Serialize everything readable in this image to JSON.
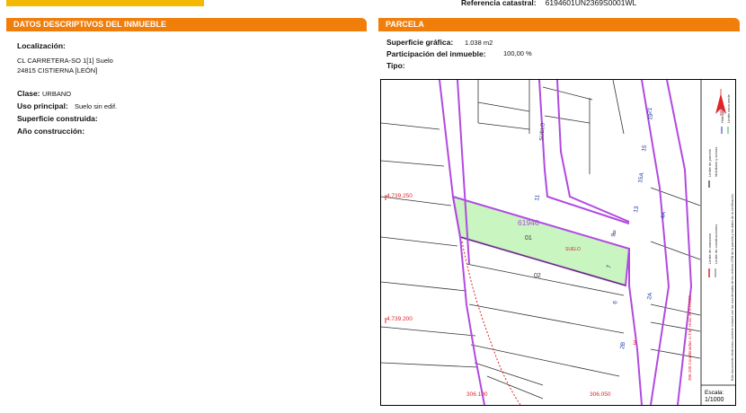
{
  "header": {
    "ref_label": "Referencia catastral:",
    "ref_value": "6194601UN2369S0001WL"
  },
  "left": {
    "title": "DATOS DESCRIPTIVOS DEL INMUEBLE",
    "localizacion_label": "Localización:",
    "address_line1": "CL CARRETERA-SO 1[1] Suelo",
    "address_line2": "24815 CISTIERNA [LEÓN]",
    "clase_label": "Clase:",
    "clase_value": "URBANO",
    "uso_label": "Uso principal:",
    "uso_value": "Suelo sin edif.",
    "superficie_construida_label": "Superficie construida:",
    "ano_label": "Año construcción:"
  },
  "right": {
    "title": "PARCELA",
    "superficie_label": "Superficie gráfica:",
    "superficie_value": "1.038 m2",
    "participacion_label": "Participación del inmueble:",
    "participacion_value": "100,00 %",
    "tipo_label": "Tipo:"
  },
  "map": {
    "parcel_number": "61946",
    "sub01": "01",
    "sub02": "02",
    "suelo": "SUELO",
    "coord_y1": "4.739.250",
    "coord_y2": "4.739.200",
    "coord_x1": "306.100",
    "coord_x2": "306.050",
    "street_numbers": [
      "21",
      "19",
      "15",
      "15A",
      "13",
      "11",
      "9",
      "7",
      "6",
      "4A",
      "2A",
      "2B"
    ],
    "other_labels": [
      "SUELO",
      "8",
      "3"
    ],
    "legend": [
      "Límite de manzana",
      "Límite de parcela",
      "Límite de construcciones",
      "Mobiliario y aceras",
      "Hidrografía",
      "Límite zona verde"
    ],
    "legend_note": "Este documento electrónico contiene enlaces con las coordenadas de los vértices UTM de la parcela y los datos de la certificación.",
    "utm_note": "306.100 Coordenadas U.T.M. Huso 30 ETRS89",
    "scale_label": "Escala:",
    "scale_value": "1/1000",
    "colors": {
      "parcel_line": "#b14ae0",
      "parcel_fill": "#c8f5c0",
      "coord_red": "#e0242a",
      "street_blue": "#1a3aa8"
    }
  }
}
